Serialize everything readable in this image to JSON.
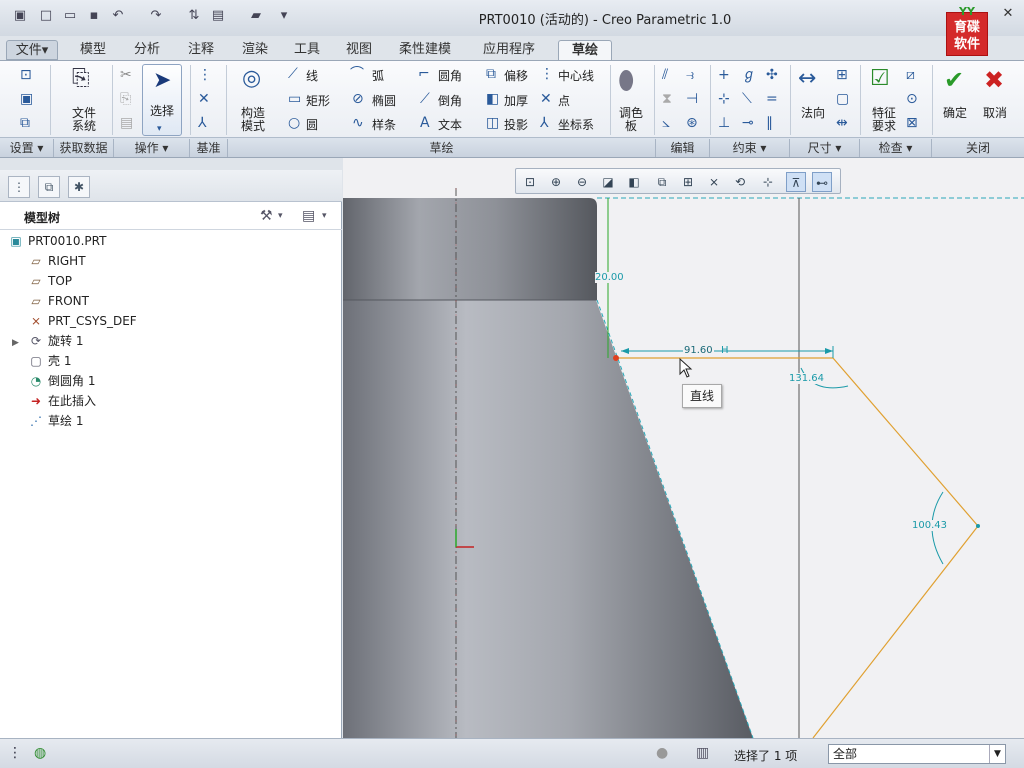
{
  "window": {
    "title": "PRT0010 (活动的) - Creo Parametric 1.0",
    "logo_top": "YY",
    "logo_text": "育碟\n软件"
  },
  "tabs": {
    "file": "文件▾",
    "items": [
      "模型",
      "分析",
      "注释",
      "渲染",
      "工具",
      "视图",
      "柔性建模",
      "应用程序",
      "草绘"
    ],
    "active": "草绘"
  },
  "ribbon": {
    "file_system": "文件\n系统",
    "select": "选择",
    "construction_mode": "构造\n模式",
    "line": "线",
    "arc": "弧",
    "fillet": "圆角",
    "offset": "偏移",
    "centerline": "中心线",
    "rectangle": "矩形",
    "ellipse": "椭圆",
    "chamfer": "倒角",
    "thicken": "加厚",
    "point": "点",
    "circle": "圆",
    "spline": "样条",
    "text": "文本",
    "project": "投影",
    "coordsys": "坐标系",
    "palette": "调色\n板",
    "normal": "法向",
    "feature_req": "特征\n要求",
    "ok": "确定",
    "cancel": "取消"
  },
  "groups": [
    "设置 ▾",
    "获取数据",
    "操作 ▾",
    "基准",
    "草绘",
    "编辑",
    "约束 ▾",
    "尺寸 ▾",
    "检查 ▾",
    "关闭"
  ],
  "model_tree": {
    "title": "模型树",
    "items": [
      {
        "label": "PRT0010.PRT",
        "icon": "part-icon"
      },
      {
        "label": "RIGHT",
        "icon": "datum-plane-icon"
      },
      {
        "label": "TOP",
        "icon": "datum-plane-icon"
      },
      {
        "label": "FRONT",
        "icon": "datum-plane-icon"
      },
      {
        "label": "PRT_CSYS_DEF",
        "icon": "csys-icon"
      },
      {
        "label": "旋转 1",
        "icon": "revolve-icon"
      },
      {
        "label": "壳 1",
        "icon": "shell-icon"
      },
      {
        "label": "倒圆角 1",
        "icon": "round-icon"
      },
      {
        "label": "在此插入",
        "icon": "insert-arrow-icon"
      },
      {
        "label": "草绘 1",
        "icon": "sketch-icon"
      }
    ]
  },
  "sketch": {
    "dim_vertical": "20.00",
    "dim_horizontal": "91.60",
    "dim_horizontal_constraint": "H",
    "dim_angle_1": "131.64",
    "dim_angle_2": "100.43",
    "tooltip": "直线"
  },
  "status": {
    "selection": "选择了 1 项",
    "filter": "全部"
  },
  "colors": {
    "accent_blue": "#2a5a9a",
    "sketch_orange": "#e0a030",
    "dim_cyan": "#1a9aa8",
    "constraint_green": "#2aa82a",
    "ok_green": "#2a9a2a",
    "cancel_red": "#cc2222"
  }
}
